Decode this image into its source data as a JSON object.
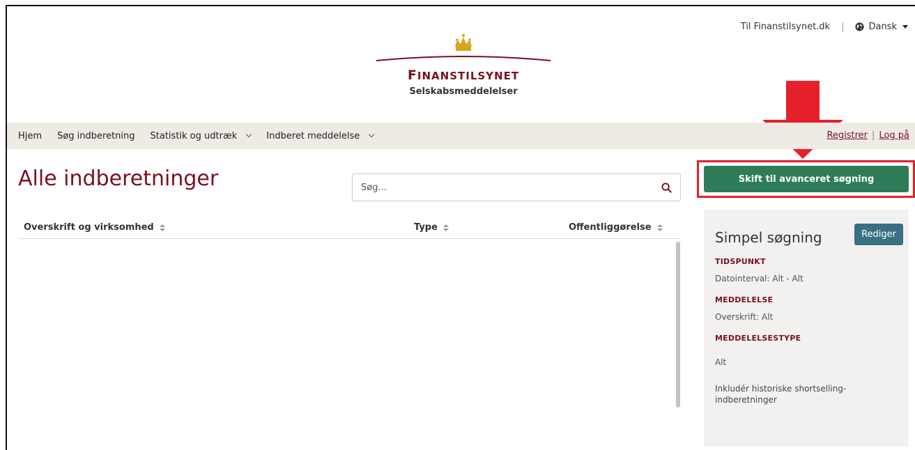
{
  "topbar": {
    "link": "Til Finanstilsynet.dk",
    "separator": "|",
    "language": "Dansk"
  },
  "logo": {
    "brand_first": "F",
    "brand_rest": "INANSTILSYNET",
    "subtitle": "Selskabsmeddelelser"
  },
  "nav": {
    "items": [
      "Hjem",
      "Søg indberetning",
      "Statistik og udtræk",
      "Indberet meddelelse"
    ],
    "register": "Registrer",
    "login": "Log på",
    "auth_sep": "|"
  },
  "main": {
    "title": "Alle indberetninger",
    "search_placeholder": "Søg...",
    "columns": [
      "Overskrift og virksomhed",
      "Type",
      "Offentliggørelse"
    ]
  },
  "sidebar": {
    "advanced_button": "Skift til avanceret søgning",
    "panel_title": "Simpel søgning",
    "edit_button": "Rediger",
    "sections": [
      {
        "heading": "TIDSPUNKT",
        "value": "Datointerval: Alt - Alt"
      },
      {
        "heading": "MEDDELELSE",
        "value": "Overskrift: Alt"
      },
      {
        "heading": "MEDDELELSESTYPE",
        "value": "Alt"
      }
    ],
    "footer_note": "Inkludér historiske shortselling-indberetninger"
  },
  "colors": {
    "brand": "#7a1120",
    "primary_button": "#2e7d58",
    "edit_button": "#3a6f84",
    "highlight": "#e5202a",
    "nav_bg": "#eeebe5"
  }
}
